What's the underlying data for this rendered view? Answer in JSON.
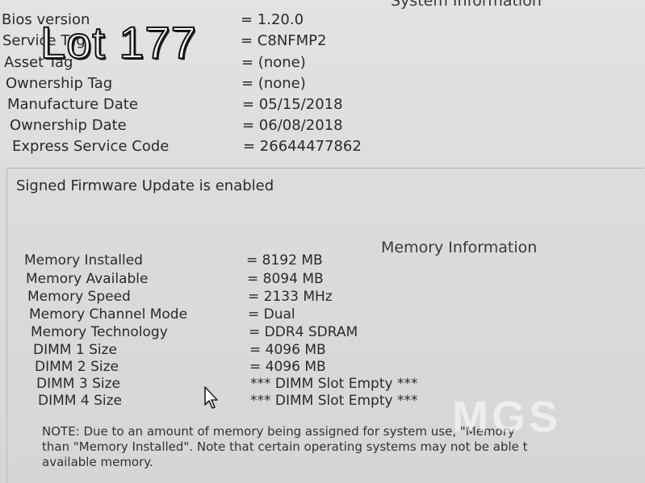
{
  "header": {
    "section_title": "System Information"
  },
  "system_info": [
    {
      "label": "Bios version",
      "value": "= 1.20.0"
    },
    {
      "label": "Service Tag",
      "value": "= C8NFMP2"
    },
    {
      "label": "Asset Tag",
      "value": "= (none)"
    },
    {
      "label": "Ownership Tag",
      "value": "= (none)"
    },
    {
      "label": "Manufacture Date",
      "value": "= 05/15/2018"
    },
    {
      "label": "Ownership Date",
      "value": "= 06/08/2018"
    },
    {
      "label": "Express Service Code",
      "value": "= 26644477862"
    }
  ],
  "firmware_status": "Signed Firmware Update is enabled",
  "memory_section_title": "Memory Information",
  "memory_info": [
    {
      "label": "Memory Installed",
      "value": "= 8192 MB"
    },
    {
      "label": "Memory Available",
      "value": "= 8094 MB"
    },
    {
      "label": "Memory Speed",
      "value": "= 2133 MHz"
    },
    {
      "label": "Memory Channel Mode",
      "value": "= Dual"
    },
    {
      "label": "Memory Technology",
      "value": "= DDR4 SDRAM"
    },
    {
      "label": "DIMM 1 Size",
      "value": "= 4096 MB"
    },
    {
      "label": "DIMM 2 Size",
      "value": "= 4096 MB"
    },
    {
      "label": "DIMM 3 Size",
      "value": "*** DIMM Slot Empty ***"
    },
    {
      "label": "DIMM 4 Size",
      "value": "*** DIMM Slot Empty ***"
    }
  ],
  "note": {
    "line1": "NOTE: Due to an amount of memory being assigned for system use, \"Memory",
    "line2": "than \"Memory Installed\". Note that certain operating systems may not be able t",
    "line3": "available memory."
  },
  "overlay": {
    "lot_label": "Lot 177",
    "watermark": "MGS"
  },
  "icons": {
    "cursor": "mouse-pointer-icon"
  }
}
